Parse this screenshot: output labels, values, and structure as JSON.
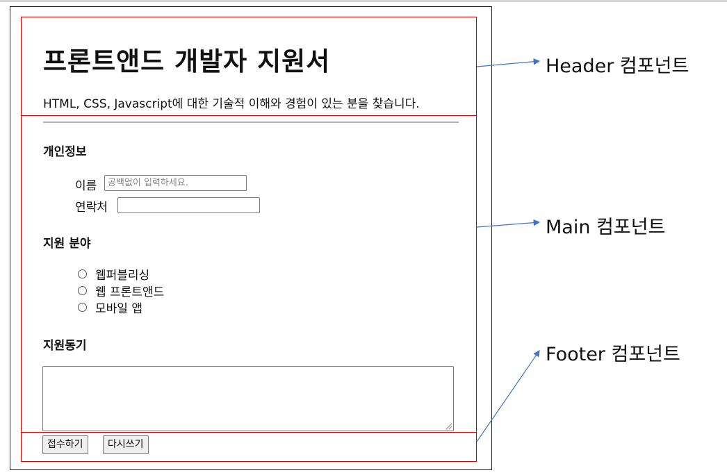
{
  "form": {
    "title": "프론트앤드 개발자 지원서",
    "subtitle": "HTML, CSS, Javascript에 대한 기술적 이해와 경험이 있는 분을 찾습니다.",
    "personal": {
      "heading": "개인정보",
      "name_label": "이름",
      "name_placeholder": "공백없이 입력하세요.",
      "name_value": "",
      "contact_label": "연락처",
      "contact_value": ""
    },
    "field": {
      "heading": "지원 분야",
      "options": [
        {
          "label": "웹퍼블리싱",
          "checked": false
        },
        {
          "label": "웹 프론트앤드",
          "checked": false
        },
        {
          "label": "모바일 앱",
          "checked": false
        }
      ]
    },
    "motive": {
      "heading": "지원동기",
      "value": ""
    },
    "buttons": {
      "submit_label": "접수하기",
      "reset_label": "다시쓰기"
    }
  },
  "annotations": {
    "header": "Header 컴포넌트",
    "main": "Main 컴포넌트",
    "footer": "Footer 컴포넌트"
  },
  "colors": {
    "component_border": "#d00000",
    "arrow": "#4472c4",
    "frame_border": "#222222"
  }
}
